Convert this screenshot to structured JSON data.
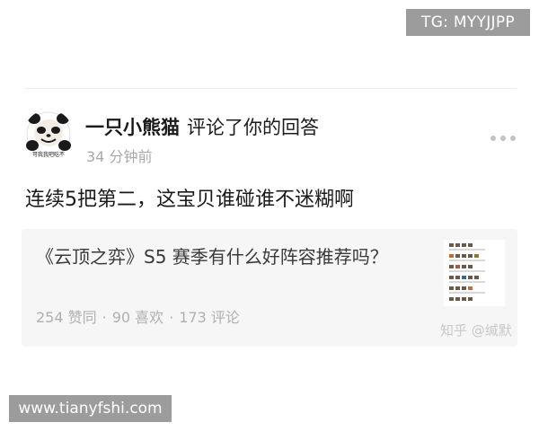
{
  "watermarks": {
    "top": "TG: MYYJJPP",
    "bottom": "www.tianyfshi.com"
  },
  "notification": {
    "user_name": "一只小熊猫",
    "action": "评论了你的回答",
    "time": "34 分钟前",
    "avatar_caption": "可我我吧吃不"
  },
  "comment": {
    "text": "连续5把第二，这宝贝谁碰谁不迷糊啊"
  },
  "answer_card": {
    "title": "《云顶之弈》S5 赛季有什么好阵容推荐吗？",
    "stats": {
      "likes": "254 赞同",
      "favorites": "90 喜欢",
      "comments": "173 评论",
      "separator": "·"
    }
  },
  "source_mark": "知乎 @缄默",
  "icons": {
    "more": "more-horizontal-icon",
    "avatar": "panda-meme-avatar"
  },
  "colors": {
    "watermark_bg": "#9c9c9c",
    "card_bg": "#f6f6f6",
    "muted_text": "#a9a9a9"
  }
}
